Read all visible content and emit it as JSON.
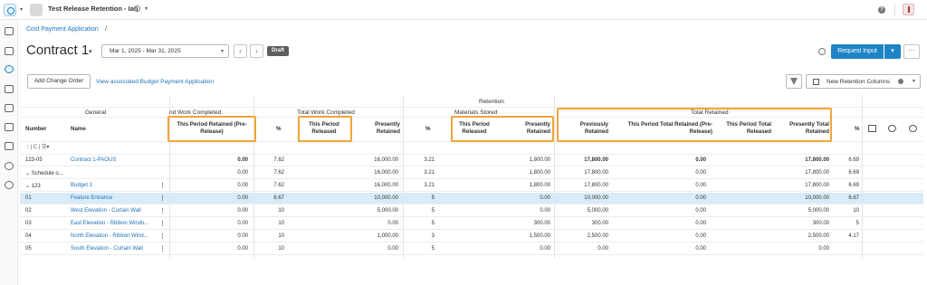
{
  "topbar": {
    "project_title": "Test Release Retention - Ian",
    "help_label": "?",
    "dropdown_glyph": "▾"
  },
  "rail": {
    "icons": [
      "home-icon",
      "dashboard-icon",
      "cost-icon",
      "budget-icon",
      "vehicle-icon",
      "document-icon",
      "forms-icon",
      "people-icon",
      "settings-icon"
    ]
  },
  "header": {
    "breadcrumb": "Cost Payment Application",
    "breadcrumb_sep": "/",
    "title": "Contract 1",
    "title_caret": "▾",
    "date_range": "Mar 1, 2025 - Mar 31, 2025",
    "date_caret": "▾",
    "prev_label": "‹",
    "next_label": "›",
    "status_badge": "Draft",
    "request_button": "Request Input",
    "request_caret": "▾",
    "more_label": "···"
  },
  "toolbar": {
    "add_change_order": "Add Change Order",
    "view_link": "View associated Budget Payment Application",
    "columns_select": "New Retention Columns",
    "columns_caret": "▾"
  },
  "table": {
    "group_headers": {
      "retention": "Retention",
      "general": "General",
      "work_completed_partial": "nd Work Completed",
      "total_work_completed": "Total Work Completed",
      "materials_stored": "Materials Stored",
      "total_retained": "Total Retained"
    },
    "columns": {
      "number": "Number",
      "name": "Name",
      "this_period_retained_pre_release": "This Period Retained (Pre-Release)",
      "pct1": "%",
      "this_period_released": "This Period Released",
      "presently_retained": "Presently Retained",
      "pct2": "%",
      "ms_this_period_released": "This Period Released",
      "ms_presently_retained": "Presently Retained",
      "previously_retained": "Previously Retained",
      "tr_this_period_total_retained": "This Period Total Retained (Pre-Release)",
      "tr_this_period_total_released": "This Period Total Released",
      "tr_presently_total_retained": "Presently Total Retained",
      "pct3": "%"
    },
    "filter_row": "⁝  |  C  |  ☰▾",
    "rows": [
      {
        "number": "123-05",
        "name": "Contract 1-PAOUS",
        "pre_release": "0.00",
        "pct1": "7.62",
        "presently": "16,000.00",
        "pct2": "3.21",
        "ms_presently": "1,800.00",
        "previously": "17,800.00",
        "tp_total_retained": "0.00",
        "presently_total": "17,800.00",
        "pct3": "6.69",
        "kebab": false,
        "selected": false,
        "bold": true,
        "link": true
      },
      {
        "number": "⌄ Schedule o...",
        "name": "",
        "pre_release": "0.00",
        "pct1": "7.62",
        "presently": "16,000.00",
        "pct2": "3.21",
        "ms_presently": "1,800.00",
        "previously": "17,800.00",
        "tp_total_retained": "0.00",
        "presently_total": "17,800.00",
        "pct3": "6.69",
        "kebab": false,
        "selected": false,
        "bold": false,
        "link": false
      },
      {
        "number": "⌄ 123",
        "name": "Budget 1",
        "pre_release": "0.00",
        "pct1": "7.62",
        "presently": "16,000.00",
        "pct2": "3.21",
        "ms_presently": "1,800.00",
        "previously": "17,800.00",
        "tp_total_retained": "0.00",
        "presently_total": "17,800.00",
        "pct3": "6.69",
        "kebab": true,
        "selected": false,
        "bold": false,
        "link": true
      },
      {
        "number": "01",
        "name": "Feature Entrance",
        "pre_release": "0.00",
        "pct1": "6.67",
        "presently": "10,000.00",
        "pct2": "5",
        "ms_presently": "0.00",
        "previously": "10,000.00",
        "tp_total_retained": "0.00",
        "presently_total": "10,000.00",
        "pct3": "6.67",
        "kebab": true,
        "selected": true,
        "bold": false,
        "link": true
      },
      {
        "number": "02",
        "name": "West Elevation - Curtain Wall",
        "pre_release": "0.00",
        "pct1": "10",
        "presently": "5,000.00",
        "pct2": "5",
        "ms_presently": "0.00",
        "previously": "5,000.00",
        "tp_total_retained": "0.00",
        "presently_total": "5,000.00",
        "pct3": "10",
        "kebab": true,
        "selected": false,
        "bold": false,
        "link": true
      },
      {
        "number": "03",
        "name": "East Elevation - Ribbon Windo...",
        "pre_release": "0.00",
        "pct1": "10",
        "presently": "0.00",
        "pct2": "5",
        "ms_presently": "300.00",
        "previously": "300.00",
        "tp_total_retained": "0.00",
        "presently_total": "300.00",
        "pct3": "5",
        "kebab": true,
        "selected": false,
        "bold": false,
        "link": true
      },
      {
        "number": "04",
        "name": "North Elevation - Ribbon Wind...",
        "pre_release": "0.00",
        "pct1": "10",
        "presently": "1,000.00",
        "pct2": "3",
        "ms_presently": "1,500.00",
        "previously": "2,500.00",
        "tp_total_retained": "0.00",
        "presently_total": "2,500.00",
        "pct3": "4.17",
        "kebab": true,
        "selected": false,
        "bold": false,
        "link": true
      },
      {
        "number": "05",
        "name": "South Elevation - Curtain Wall",
        "pre_release": "0.00",
        "pct1": "10",
        "presently": "0.00",
        "pct2": "5",
        "ms_presently": "0.00",
        "previously": "0.00",
        "tp_total_retained": "0.00",
        "presently_total": "0.00",
        "pct3": "",
        "kebab": true,
        "selected": false,
        "bold": false,
        "link": true
      }
    ]
  },
  "colors": {
    "accent": "#1f84c6",
    "highlight_box": "#f0a53a",
    "selected_row": "#d8ebf8"
  }
}
